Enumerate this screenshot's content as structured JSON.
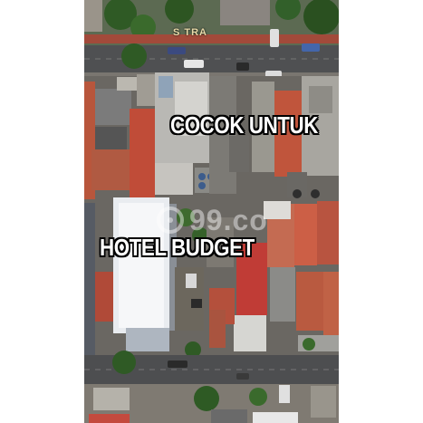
{
  "captions": {
    "top": "COCOK UNTUK",
    "middle": "HOTEL BUDGET"
  },
  "watermark": {
    "text": "99.co",
    "icon": "99co-logo-icon"
  },
  "street_sign": "S TRA",
  "colors": {
    "caption_text": "#ffffff",
    "caption_outline": "#000000",
    "roof_red": "#c9553f",
    "road": "#5a5a5a"
  }
}
